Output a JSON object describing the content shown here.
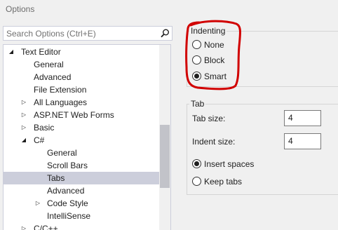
{
  "window": {
    "title": "Options"
  },
  "search": {
    "placeholder": "Search Options (Ctrl+E)"
  },
  "tree": {
    "text_editor": "Text Editor",
    "general": "General",
    "advanced": "Advanced",
    "file_extension": "File Extension",
    "all_languages": "All Languages",
    "aspnet": "ASP.NET Web Forms",
    "basic": "Basic",
    "csharp": "C#",
    "cs_general": "General",
    "cs_scrollbars": "Scroll Bars",
    "cs_tabs": "Tabs",
    "cs_advanced": "Advanced",
    "cs_codestyle": "Code Style",
    "cs_intellisense": "IntelliSense",
    "cpp": "C/C++"
  },
  "indenting": {
    "title": "Indenting",
    "none_label": "None",
    "block_label": "Block",
    "smart_label": "Smart",
    "selected": "Smart"
  },
  "tab": {
    "title": "Tab",
    "tab_size_label": "Tab size:",
    "tab_size_value": "4",
    "indent_size_label": "Indent size:",
    "indent_size_value": "4",
    "insert_spaces_label": "Insert spaces",
    "keep_tabs_label": "Keep tabs",
    "selected": "Insert spaces"
  },
  "annotation_color": "#d10000"
}
